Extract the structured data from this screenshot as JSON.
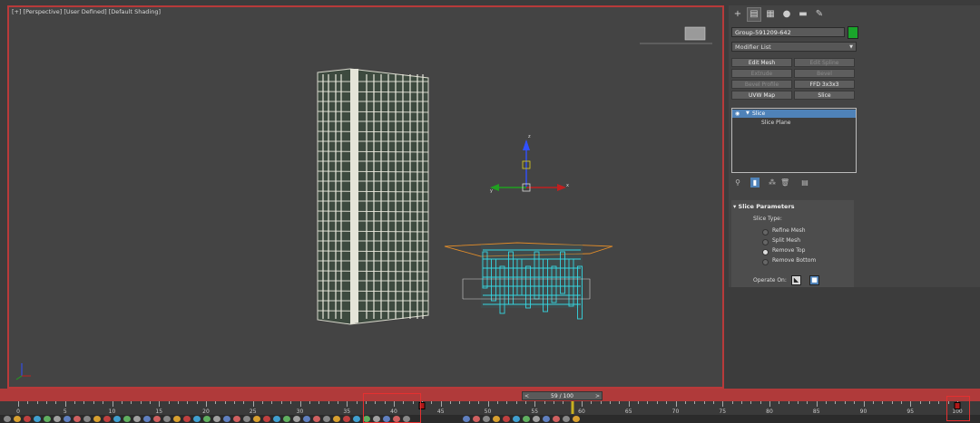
{
  "viewport": {
    "label": "[+] [Perspective] [User Defined] [Default Shading]",
    "gizmo": {
      "axis_z": "z",
      "axis_x": "x",
      "axis_y": "y"
    }
  },
  "command_panel": {
    "tabs": [
      {
        "icon": "create-icon",
        "glyph": "+"
      },
      {
        "icon": "modify-icon",
        "glyph": "▤"
      },
      {
        "icon": "hierarchy-icon",
        "glyph": "▦"
      },
      {
        "icon": "motion-icon",
        "glyph": "●"
      },
      {
        "icon": "display-icon",
        "glyph": "▬"
      },
      {
        "icon": "utilities-icon",
        "glyph": "✎"
      }
    ],
    "object_name": "Group-591209-642",
    "object_color": "#1aa52b",
    "modifier_list": "Modifier List",
    "modifier_buttons": [
      {
        "label": "Edit Mesh",
        "enabled": true
      },
      {
        "label": "Edit Spline",
        "enabled": false
      },
      {
        "label": "Extrude",
        "enabled": false
      },
      {
        "label": "Bevel",
        "enabled": false
      },
      {
        "label": "Bevel Profile",
        "enabled": false
      },
      {
        "label": "FFD 3x3x3",
        "enabled": true
      },
      {
        "label": "UVW Map",
        "enabled": true
      },
      {
        "label": "Slice",
        "enabled": true
      }
    ],
    "stack": {
      "selected": "Slice",
      "sub": "Slice Plane"
    },
    "slice_parameters": {
      "title": "Slice Parameters",
      "slice_type_label": "Slice Type:",
      "options": [
        {
          "label": "Refine Mesh",
          "checked": false
        },
        {
          "label": "Split Mesh",
          "checked": false
        },
        {
          "label": "Remove Top",
          "checked": true
        },
        {
          "label": "Remove Bottom",
          "checked": false
        }
      ],
      "operate_on_label": "Operate On:"
    }
  },
  "timeline": {
    "slider_text": "59 / 100",
    "prev_arrow": "<",
    "next_arrow": ">",
    "current_frame": 59,
    "total_frames": 100,
    "ticks": [
      0,
      5,
      10,
      15,
      20,
      25,
      30,
      35,
      40,
      45,
      50,
      55,
      60,
      65,
      70,
      75,
      80,
      85,
      90,
      95,
      100
    ],
    "tick_labels": [
      "0",
      "5",
      "10",
      "15",
      "20",
      "25",
      "30",
      "35",
      "40",
      "45",
      "50",
      "55",
      "60",
      "65",
      "70",
      "75",
      "80",
      "85",
      "90",
      "95",
      "100"
    ]
  },
  "colors": {
    "highlight": "#e53030",
    "selection": "#4f82b8",
    "bounding_box": "#e08c2a",
    "wireframe": "#36d5e0"
  }
}
